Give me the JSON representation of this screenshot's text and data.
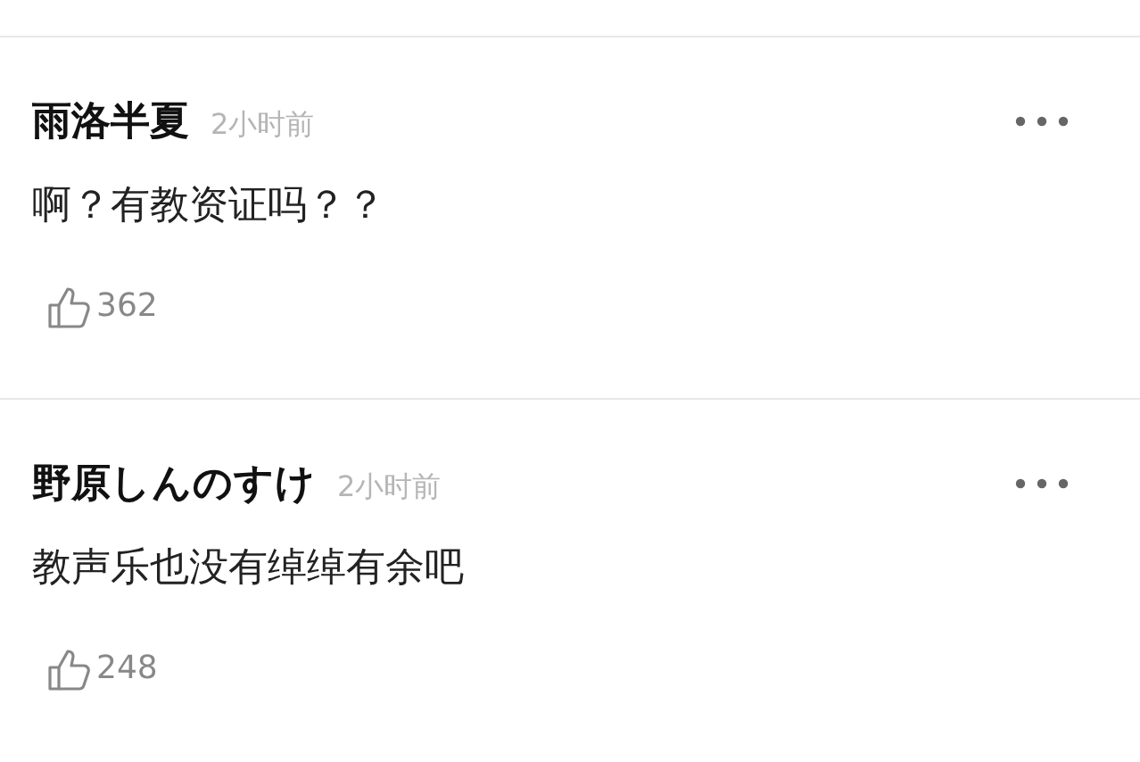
{
  "comments": [
    {
      "author": "雨洛半夏",
      "time": "2小时前",
      "text": "啊？有教资证吗？？",
      "likes": "362"
    },
    {
      "author": "野原しんのすけ",
      "time": "2小时前",
      "text": "教声乐也没有绰绰有余吧",
      "likes": "248"
    }
  ]
}
